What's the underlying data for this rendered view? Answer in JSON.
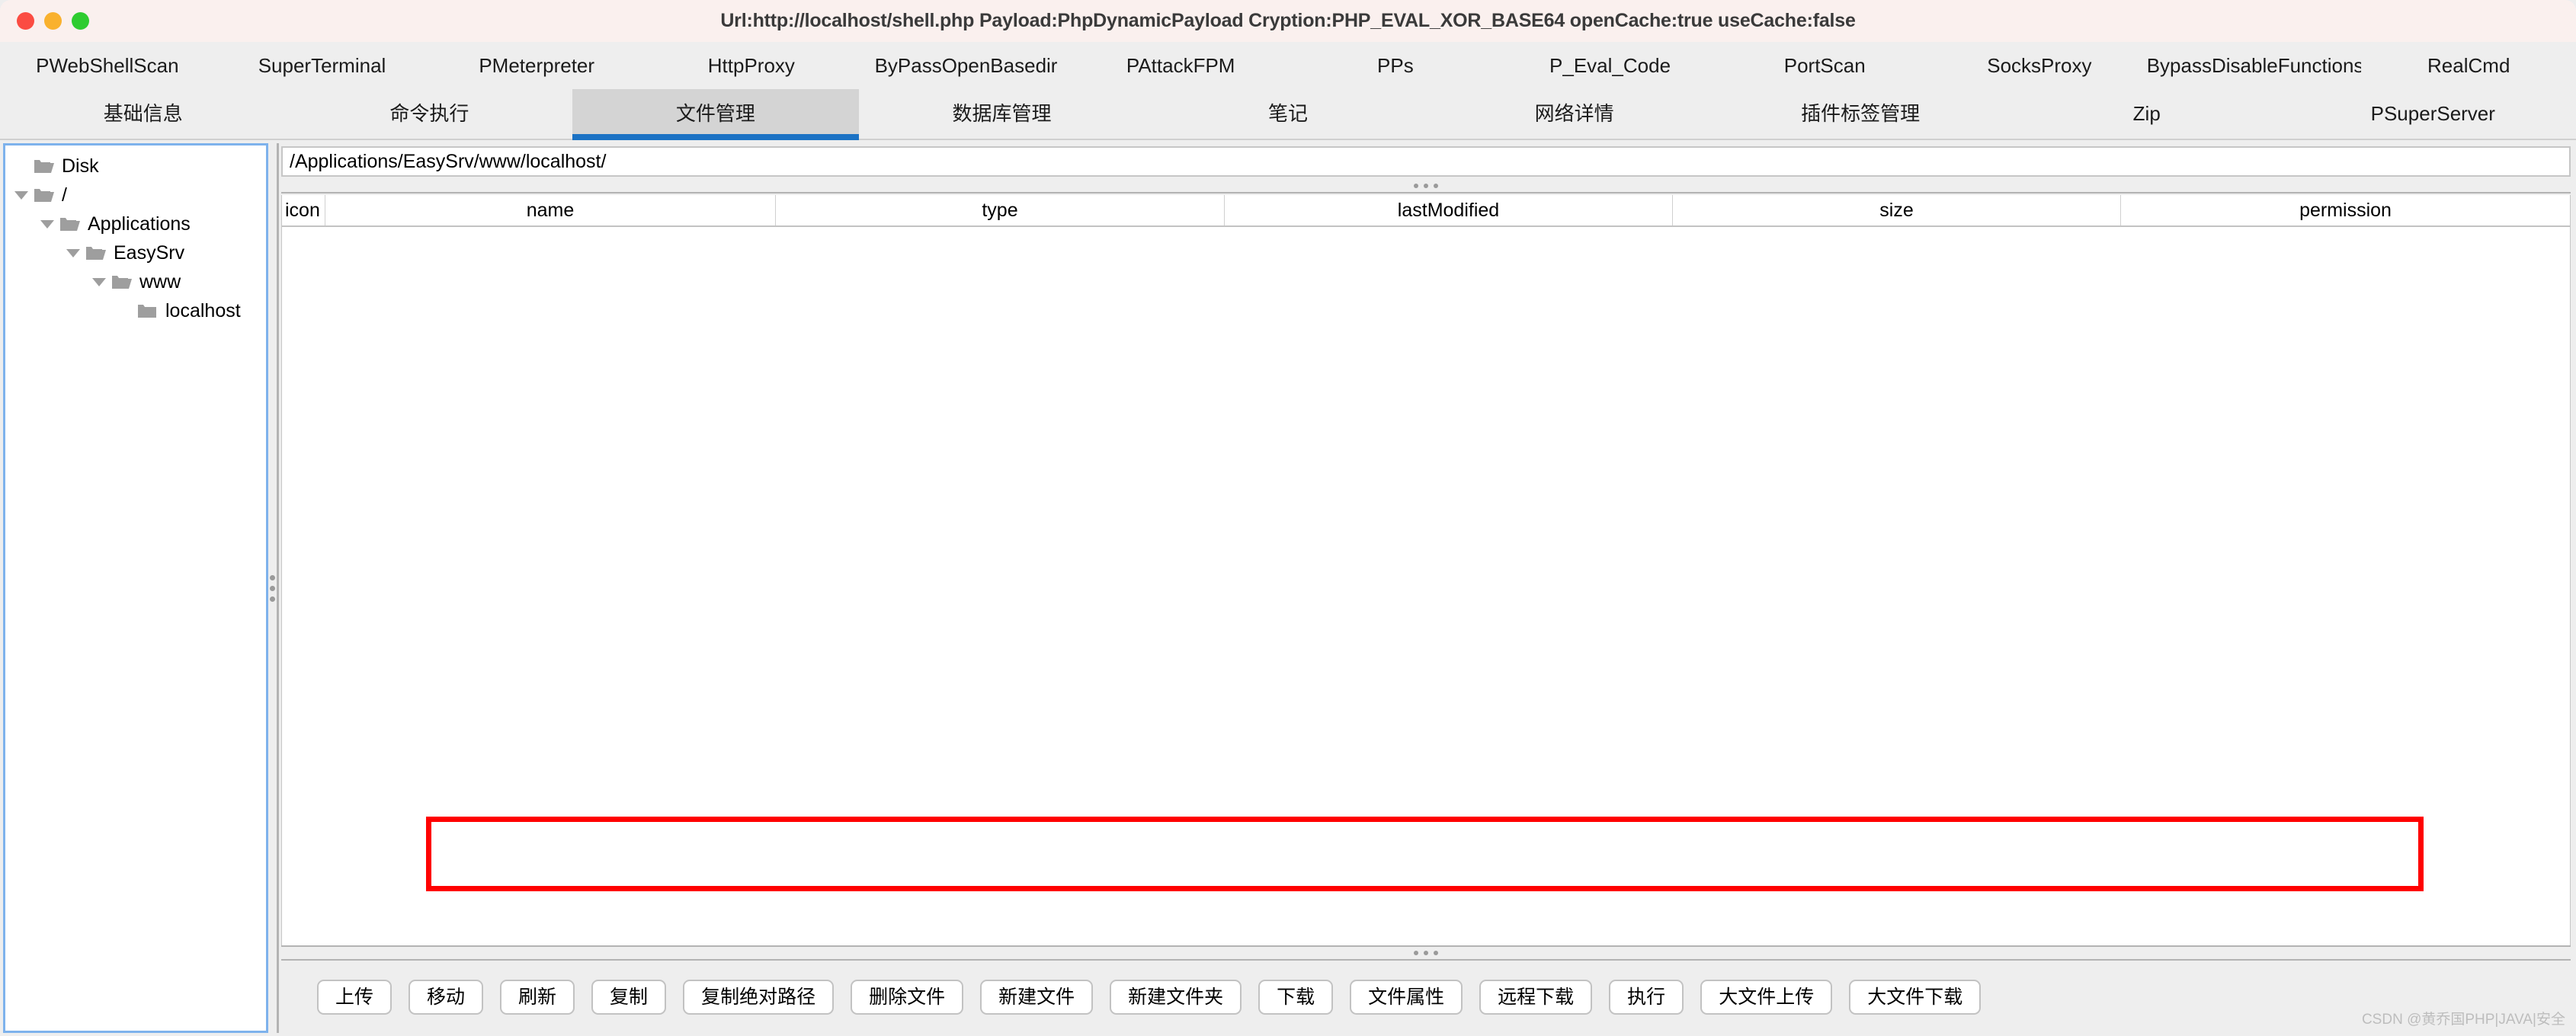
{
  "window": {
    "title": "Url:http://localhost/shell.php Payload:PhpDynamicPayload Cryption:PHP_EVAL_XOR_BASE64 openCache:true useCache:false",
    "traffic_lights": {
      "close": "close-button",
      "minimize": "minimize-button",
      "maximize": "maximize-button"
    },
    "colors": {
      "titlebar_bg": "#faf0ee",
      "close": "#fb4c42",
      "minimize": "#f9b12e",
      "maximize": "#2ecc30",
      "selected_tab_bg": "#d4d4d4",
      "selected_tab_underline": "#1b72c4",
      "tree_border": "#7eb2ec",
      "annotation": "#ff0000"
    }
  },
  "plugin_tabs": [
    {
      "label": "PWebShellScan"
    },
    {
      "label": "SuperTerminal"
    },
    {
      "label": "PMeterpreter"
    },
    {
      "label": "HttpProxy"
    },
    {
      "label": "ByPassOpenBasedir"
    },
    {
      "label": "PAttackFPM"
    },
    {
      "label": "PPs"
    },
    {
      "label": "P_Eval_Code"
    },
    {
      "label": "PortScan"
    },
    {
      "label": "SocksProxy"
    },
    {
      "label": "BypassDisableFunctions"
    },
    {
      "label": "RealCmd"
    }
  ],
  "function_tabs": [
    {
      "label": "基础信息",
      "selected": false
    },
    {
      "label": "命令执行",
      "selected": false
    },
    {
      "label": "文件管理",
      "selected": true
    },
    {
      "label": "数据库管理",
      "selected": false
    },
    {
      "label": "笔记",
      "selected": false
    },
    {
      "label": "网络详情",
      "selected": false
    },
    {
      "label": "插件标签管理",
      "selected": false
    },
    {
      "label": "Zip",
      "selected": false
    },
    {
      "label": "PSuperServer",
      "selected": false
    }
  ],
  "tree": {
    "nodes": [
      {
        "label": "Disk",
        "depth": 0,
        "expandable": false,
        "expanded": false,
        "icon": "folder-open-icon"
      },
      {
        "label": "/",
        "depth": 1,
        "expandable": true,
        "expanded": true,
        "icon": "folder-open-icon"
      },
      {
        "label": "Applications",
        "depth": 2,
        "expandable": true,
        "expanded": true,
        "icon": "folder-open-icon"
      },
      {
        "label": "EasySrv",
        "depth": 3,
        "expandable": true,
        "expanded": true,
        "icon": "folder-open-icon"
      },
      {
        "label": "www",
        "depth": 4,
        "expandable": true,
        "expanded": true,
        "icon": "folder-open-icon"
      },
      {
        "label": "localhost",
        "depth": 5,
        "expandable": false,
        "expanded": false,
        "icon": "folder-closed-icon"
      }
    ]
  },
  "path_bar": {
    "value": "/Applications/EasySrv/www/localhost/",
    "placeholder": "/"
  },
  "file_table": {
    "columns": [
      "icon",
      "name",
      "type",
      "lastModified",
      "size",
      "permission"
    ],
    "rows": []
  },
  "action_buttons": [
    {
      "label": "上传"
    },
    {
      "label": "移动"
    },
    {
      "label": "刷新"
    },
    {
      "label": "复制"
    },
    {
      "label": "复制绝对路径"
    },
    {
      "label": "删除文件"
    },
    {
      "label": "新建文件"
    },
    {
      "label": "新建文件夹"
    },
    {
      "label": "下载"
    },
    {
      "label": "文件属性"
    },
    {
      "label": "远程下载"
    },
    {
      "label": "执行"
    },
    {
      "label": "大文件上传"
    },
    {
      "label": "大文件下载"
    }
  ],
  "watermark": "CSDN @黄乔国PHP|JAVA|安全"
}
